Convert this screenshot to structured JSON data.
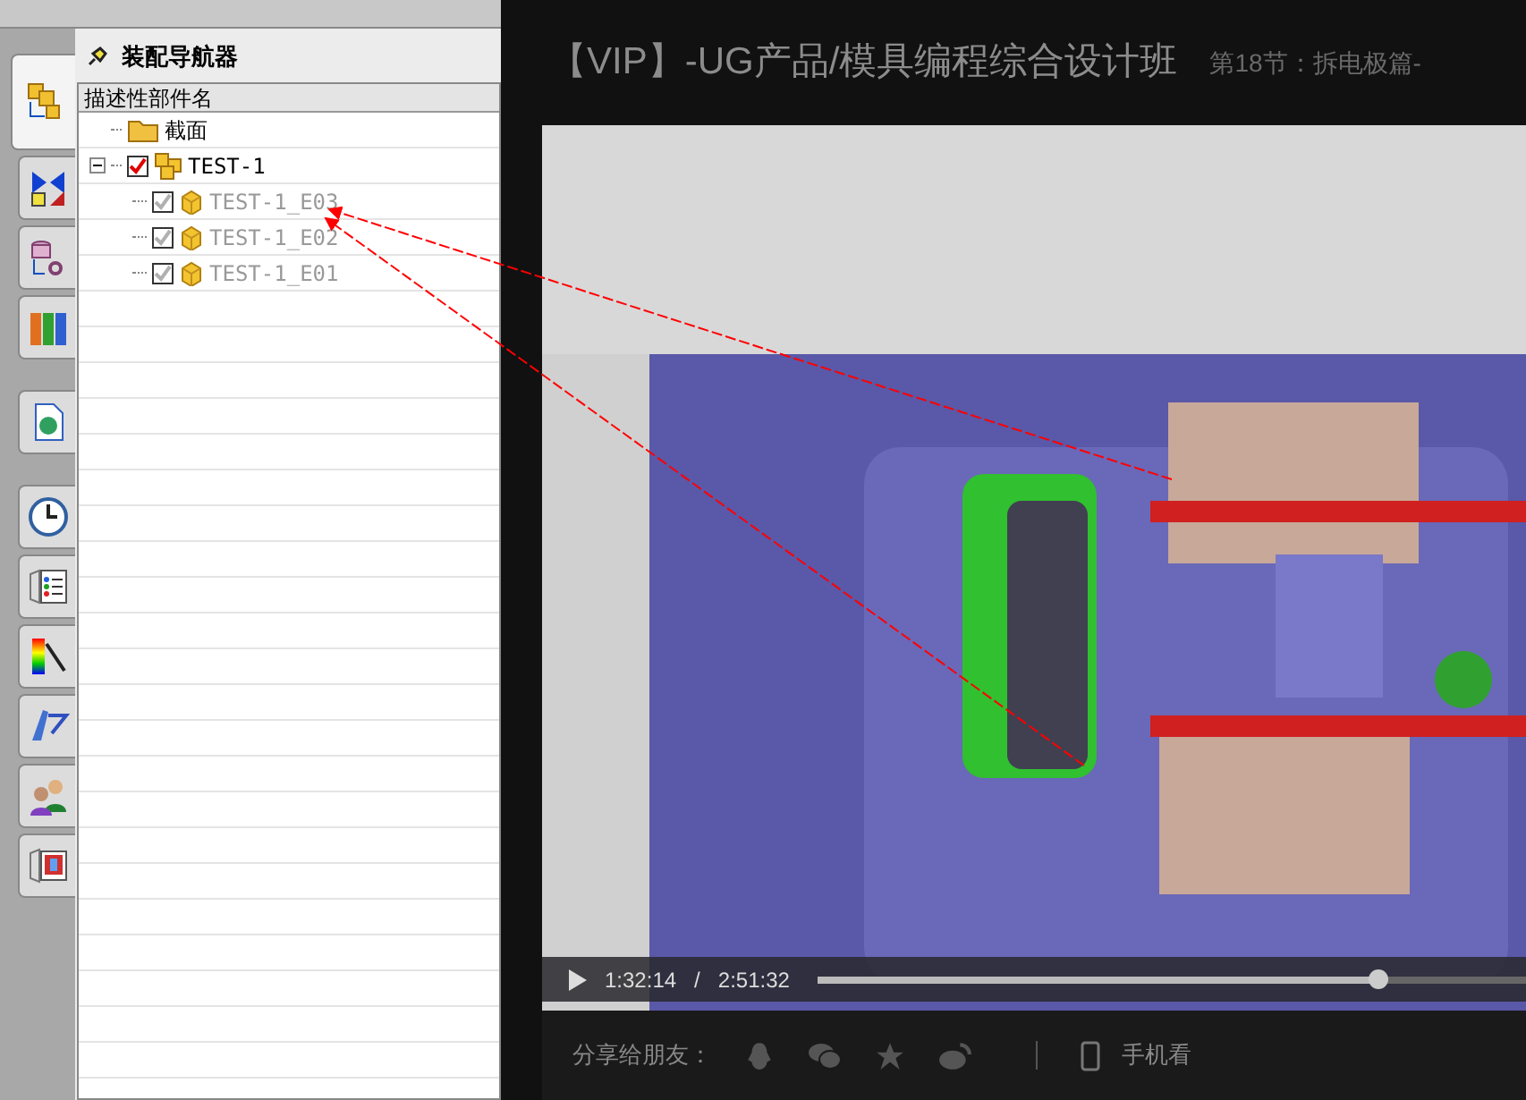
{
  "side_tabs": [
    {
      "kind": "assembly",
      "selected": true
    },
    {
      "kind": "constraint",
      "selected": false
    },
    {
      "kind": "part",
      "selected": false
    },
    {
      "kind": "books",
      "selected": false
    },
    {
      "kind": "web",
      "selected": false
    },
    {
      "kind": "clock",
      "selected": false
    },
    {
      "kind": "list",
      "selected": false
    },
    {
      "kind": "palette",
      "selected": false
    },
    {
      "kind": "tool",
      "selected": false
    },
    {
      "kind": "people",
      "selected": false
    },
    {
      "kind": "film",
      "selected": false
    }
  ],
  "navigator": {
    "title": "装配导航器",
    "column": "描述性部件名",
    "tree": [
      {
        "kind": "folder",
        "label": "截面"
      },
      {
        "kind": "assembly",
        "label": "TEST-1",
        "checked": true,
        "expanded": true,
        "dimmed": false,
        "children": [
          {
            "kind": "part",
            "label": "TEST-1_E03",
            "checked": true,
            "dimmed": true
          },
          {
            "kind": "part",
            "label": "TEST-1_E02",
            "checked": true,
            "dimmed": true
          },
          {
            "kind": "part",
            "label": "TEST-1_E01",
            "checked": true,
            "dimmed": true
          }
        ]
      }
    ]
  },
  "course": {
    "title": "【VIP】-UG产品/模具编程综合设计班",
    "lesson": "第18节：拆电极篇-"
  },
  "player": {
    "current": "1:32:14",
    "separator": "/",
    "total": "2:51:32",
    "level": 0.79
  },
  "share": {
    "label": "分享给朋友：",
    "mobile": "手机看"
  }
}
